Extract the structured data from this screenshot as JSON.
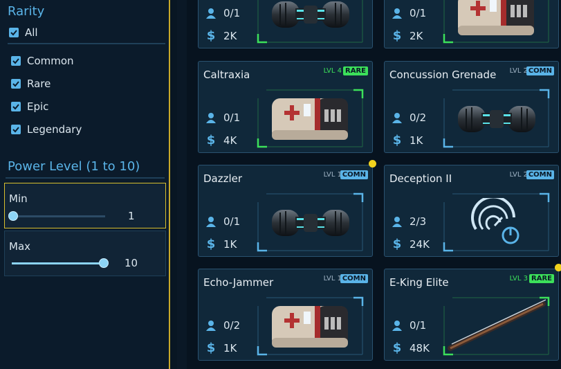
{
  "filters": {
    "rarity_title": "Rarity",
    "all_label": "All",
    "options": [
      {
        "label": "Common",
        "checked": true
      },
      {
        "label": "Rare",
        "checked": true
      },
      {
        "label": "Epic",
        "checked": true
      },
      {
        "label": "Legendary",
        "checked": true
      }
    ],
    "power_title": "Power Level (1 to 10)",
    "min": {
      "label": "Min",
      "value": "1"
    },
    "max": {
      "label": "Max",
      "value": "10"
    }
  },
  "cards": [
    {
      "name": "",
      "lvl": "",
      "badge": "",
      "owned": "0/1",
      "price": "2K",
      "item": "capsule-blue",
      "frame": "#3ce05a"
    },
    {
      "name": "",
      "lvl": "",
      "badge": "",
      "owned": "0/1",
      "price": "2K",
      "item": "capsule-medkit",
      "frame": "#3ce05a"
    },
    {
      "name": "Caltraxia",
      "lvl": "LVL 4",
      "badge": "RARE",
      "owned": "0/1",
      "price": "4K",
      "item": "capsule-medkit",
      "frame": "#3ce05a"
    },
    {
      "name": "Concussion Grenade",
      "lvl": "LVL 2",
      "badge": "COMN",
      "owned": "0/2",
      "price": "1K",
      "item": "capsule-blue",
      "frame": "#5ab4e8"
    },
    {
      "name": "Dazzler",
      "lvl": "LVL 1",
      "badge": "COMN",
      "owned": "0/1",
      "price": "1K",
      "item": "capsule-blue",
      "frame": "#5ab4e8"
    },
    {
      "name": "Deception II",
      "lvl": "LVL 2",
      "badge": "COMN",
      "owned": "2/3",
      "price": "24K",
      "item": "gauge-power",
      "frame": "#5ab4e8"
    },
    {
      "name": "Echo-Jammer",
      "lvl": "LVL 1",
      "badge": "COMN",
      "owned": "0/2",
      "price": "1K",
      "item": "capsule-medkit",
      "frame": "#5ab4e8"
    },
    {
      "name": "E-King Elite",
      "lvl": "LVL 3",
      "badge": "RARE",
      "owned": "0/1",
      "price": "48K",
      "item": "rod-weapon",
      "frame": "#3ce05a"
    }
  ],
  "colors": {
    "accent": "#5ab4e8",
    "rare": "#3ce05a",
    "common": "#5ab4e8",
    "highlight": "#f1d21d"
  }
}
